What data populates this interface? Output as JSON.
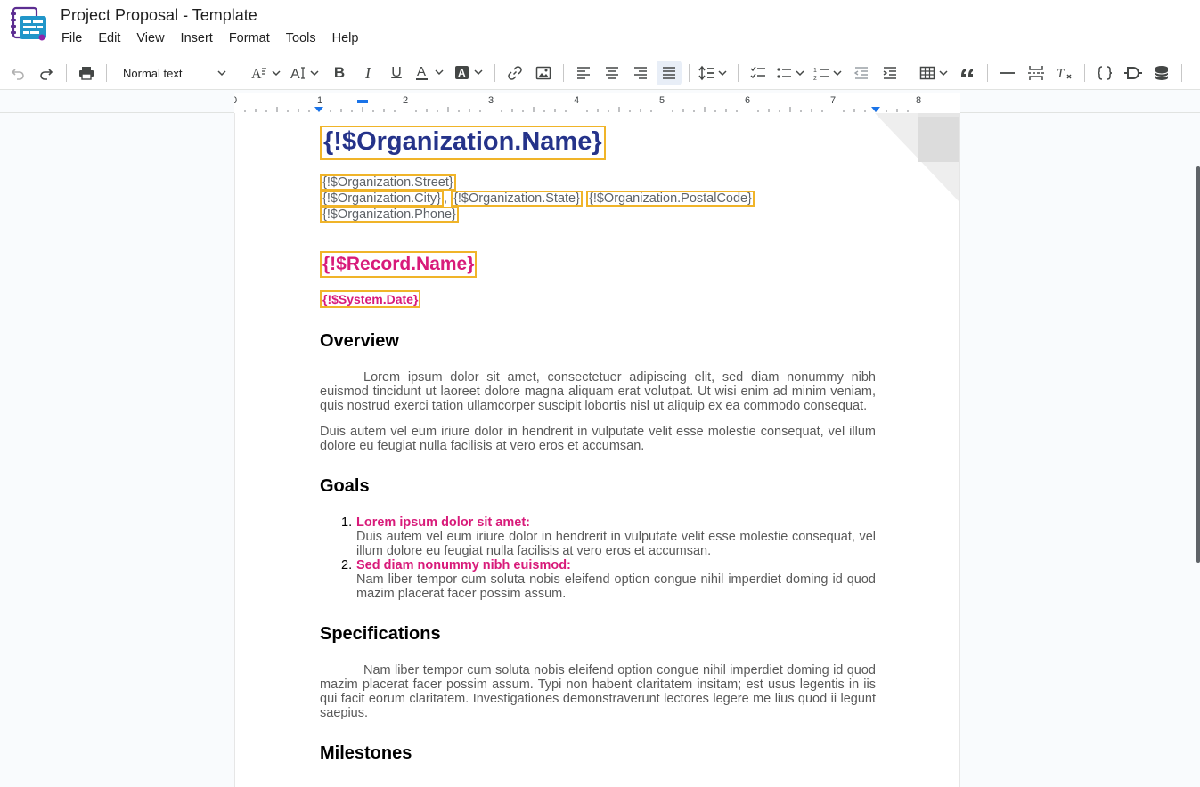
{
  "app": {
    "title": "Project Proposal - Template",
    "logo_icon": "docs-template-icon"
  },
  "menu": {
    "items": [
      "File",
      "Edit",
      "View",
      "Insert",
      "Format",
      "Tools",
      "Help"
    ]
  },
  "toolbar": {
    "style_select": "Normal text"
  },
  "ruler": {
    "labels": [
      "0",
      "1",
      "2",
      "3",
      "4",
      "5",
      "6",
      "7",
      "8"
    ]
  },
  "document": {
    "org_name": "{!$Organization.Name}",
    "street": "{!$Organization.Street}",
    "city": "{!$Organization.City}",
    "sep_comma": ",",
    "state": "{!$Organization.State}",
    "postal": "{!$Organization.PostalCode}",
    "phone": "{!$Organization.Phone}",
    "record_name": "{!$Record.Name}",
    "system_date": "{!$System.Date}",
    "overview": {
      "heading": "Overview",
      "p1": "Lorem ipsum dolor sit amet, consectetuer adipiscing elit, sed diam nonummy nibh euismod tincidunt ut laoreet dolore magna aliquam erat volutpat. Ut wisi enim ad minim veniam, quis nostrud exerci tation ullamcorper suscipit lobortis nisl ut aliquip ex ea commodo consequat.",
      "p2": "Duis autem vel eum iriure dolor in hendrerit in vulputate velit esse molestie consequat, vel illum dolore eu feugiat nulla facilisis at vero eros et accumsan."
    },
    "goals": {
      "heading": "Goals",
      "items": [
        {
          "num": "1.",
          "title": "Lorem ipsum dolor sit amet:",
          "text": "Duis autem vel eum iriure dolor in hendrerit in vulputate velit esse molestie consequat, vel illum dolore eu feugiat nulla facilisis at vero eros et accumsan."
        },
        {
          "num": "2.",
          "title": "Sed diam nonummy nibh euismod:",
          "text": "Nam liber tempor cum soluta nobis eleifend option congue nihil imperdiet doming id quod mazim placerat facer possim assum."
        }
      ]
    },
    "specifications": {
      "heading": "Specifications",
      "p1": "Nam liber tempor cum soluta nobis eleifend option congue nihil imperdiet doming id quod mazim placerat facer possim assum. Typi non habent claritatem insitam; est usus legentis in iis qui facit eorum claritatem. Investigationes demonstraverunt lectores legere me lius quod ii legunt saepius."
    },
    "milestones": {
      "heading": "Milestones"
    }
  },
  "colors": {
    "accent_blue": "#25338a",
    "accent_pink": "#d81b7a",
    "field_border": "#f0b429"
  }
}
